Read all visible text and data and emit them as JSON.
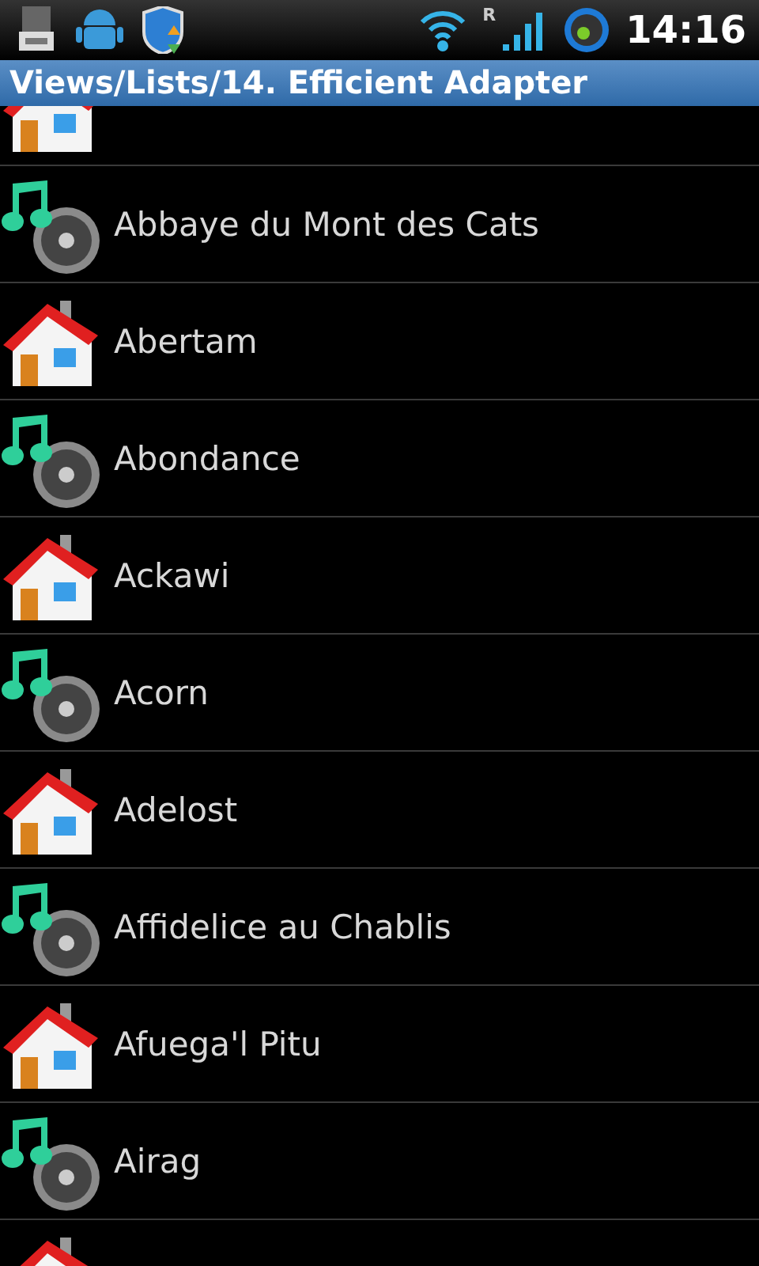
{
  "status_bar": {
    "roaming": "R",
    "time": "14:16"
  },
  "title": "Views/Lists/14. Efficient Adapter",
  "rows": [
    {
      "kind": "house",
      "partial": true
    },
    {
      "kind": "music",
      "label": "Abbaye du Mont des Cats"
    },
    {
      "kind": "house",
      "label": "Abertam"
    },
    {
      "kind": "music",
      "label": "Abondance"
    },
    {
      "kind": "house",
      "label": "Ackawi"
    },
    {
      "kind": "music",
      "label": "Acorn"
    },
    {
      "kind": "house",
      "label": "Adelost"
    },
    {
      "kind": "music",
      "label": "Affidelice au Chablis"
    },
    {
      "kind": "house",
      "label": "Afuega'l Pitu"
    },
    {
      "kind": "music",
      "label": "Airag"
    },
    {
      "kind": "house"
    }
  ]
}
